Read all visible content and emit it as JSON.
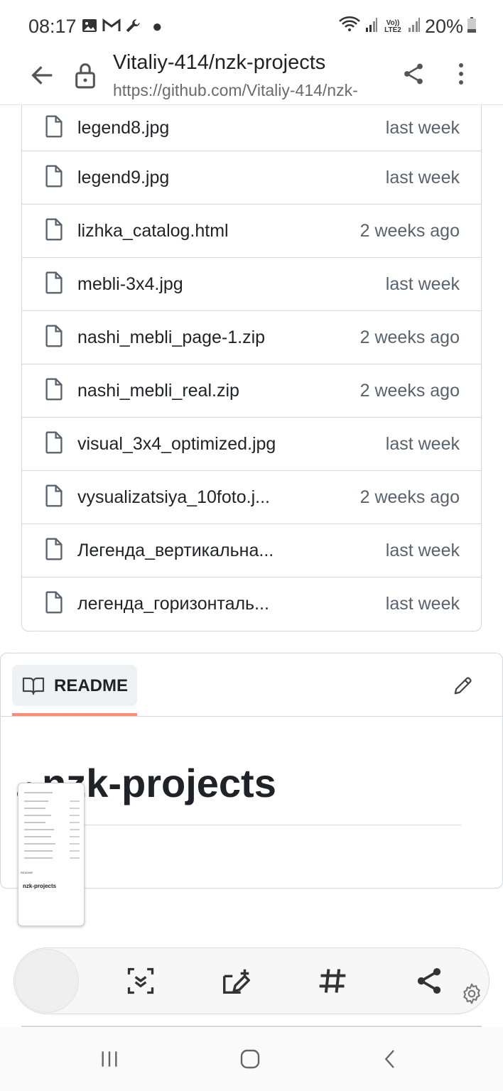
{
  "status_bar": {
    "time": "08:17",
    "battery": "20%",
    "network_label": "Vo)) LTE2",
    "icons": [
      "image-icon",
      "gmail-icon",
      "wrench-icon",
      "dot-icon",
      "wifi-icon",
      "signal-icon",
      "signal-2-icon",
      "battery-icon"
    ]
  },
  "browser": {
    "title": "Vitaliy-414/nzk-projects",
    "url": "https://github.com/Vitaliy-414/nzk-",
    "icons": [
      "back-arrow-icon",
      "lock-icon",
      "share-icon",
      "more-vert-icon"
    ]
  },
  "files": [
    {
      "name": "legend8.jpg",
      "date": "last week"
    },
    {
      "name": "legend9.jpg",
      "date": "last week"
    },
    {
      "name": "lizhka_catalog.html",
      "date": "2 weeks ago"
    },
    {
      "name": "mebli-3x4.jpg",
      "date": "last week"
    },
    {
      "name": "nashi_mebli_page-1.zip",
      "date": "2 weeks ago"
    },
    {
      "name": "nashi_mebli_real.zip",
      "date": "2 weeks ago"
    },
    {
      "name": "visual_3x4_optimized.jpg",
      "date": "last week"
    },
    {
      "name": "vysualizatsiya_10foto.j...",
      "date": "2 weeks ago"
    },
    {
      "name": "Легенда_вертикальна...",
      "date": "last week"
    },
    {
      "name": "легенда_горизонталь...",
      "date": "last week"
    }
  ],
  "readme": {
    "tab_label": "README",
    "heading": "nzk-projects",
    "icons": [
      "book-icon",
      "pencil-icon",
      "link-icon"
    ]
  },
  "thumbnail": {
    "heading": "nzk-projects",
    "tab_label": "README"
  },
  "capture_toolbar": {
    "icons": [
      "scroll-capture-icon",
      "draw-crop-icon",
      "hashtag-icon",
      "share-icon",
      "settings-icon"
    ]
  },
  "nav_bar": {
    "icons": [
      "recents-icon",
      "home-icon",
      "back-icon"
    ]
  },
  "colors": {
    "readme_underline": "#fd8c73",
    "border": "#d0d7de",
    "muted_text": "#59636e",
    "text": "#1f2328"
  }
}
